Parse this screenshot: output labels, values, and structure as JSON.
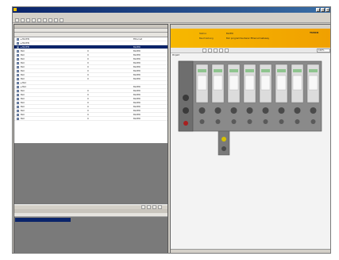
{
  "colors": {
    "title_bar": "#0a246a",
    "header_band": "#f7b800",
    "selection": "#0a246a"
  },
  "tree": {
    "rows": [
      {
        "name": "▸ BLCEN",
        "col2": "",
        "col3": "",
        "col4": "",
        "type": "Ethernet",
        "sel": false
      },
      {
        "name": "▸ BLCEN",
        "col2": "",
        "col3": "",
        "col4": "",
        "type": "",
        "sel": false
      },
      {
        "name": "▸ BLCEN",
        "col2": "",
        "col3": "",
        "col4": "",
        "type": "BLCEN",
        "sel": true
      },
      {
        "name": "BLC",
        "col2": "0",
        "col3": "",
        "col4": "",
        "type": "BLCEN",
        "sel": false
      },
      {
        "name": "BLC",
        "col2": "0",
        "col3": "",
        "col4": "",
        "type": "BLCEN",
        "sel": false
      },
      {
        "name": "BLC",
        "col2": "0",
        "col3": "",
        "col4": "",
        "type": "BLCEN",
        "sel": false
      },
      {
        "name": "BLC",
        "col2": "0",
        "col3": "",
        "col4": "",
        "type": "BLCEN",
        "sel": false
      },
      {
        "name": "BLC",
        "col2": "0",
        "col3": "",
        "col4": "",
        "type": "BLCEN",
        "sel": false
      },
      {
        "name": "BLC",
        "col2": "0",
        "col3": "",
        "col4": "",
        "type": "BLCEN",
        "sel": false
      },
      {
        "name": "BLC",
        "col2": "0",
        "col3": "",
        "col4": "",
        "type": "BLCEN",
        "sel": false
      },
      {
        "name": "BLC",
        "col2": "0",
        "col3": "",
        "col4": "",
        "type": "BLCEN",
        "sel": false
      },
      {
        "name": "▸ BLC",
        "col2": "",
        "col3": "",
        "col4": "",
        "type": "",
        "sel": false
      },
      {
        "name": "▸ BLC",
        "col2": "",
        "col3": "",
        "col4": "",
        "type": "BLCEN",
        "sel": false
      },
      {
        "name": "BLC",
        "col2": "0",
        "col3": "",
        "col4": "",
        "type": "BLCEN",
        "sel": false
      },
      {
        "name": "BLC",
        "col2": "0",
        "col3": "",
        "col4": "",
        "type": "BLCEN",
        "sel": false
      },
      {
        "name": "BLC",
        "col2": "0",
        "col3": "",
        "col4": "",
        "type": "BLCEN",
        "sel": false
      },
      {
        "name": "BLC",
        "col2": "0",
        "col3": "",
        "col4": "",
        "type": "BLCEN",
        "sel": false
      },
      {
        "name": "BLC",
        "col2": "0",
        "col3": "",
        "col4": "",
        "type": "BLCEN",
        "sel": false
      },
      {
        "name": "BLC",
        "col2": "0",
        "col3": "",
        "col4": "",
        "type": "BLCEN",
        "sel": false
      },
      {
        "name": "BLC",
        "col2": "0",
        "col3": "",
        "col4": "",
        "type": "BLCEN",
        "sel": false
      },
      {
        "name": "BLC",
        "col2": "0",
        "col3": "",
        "col4": "",
        "type": "BLCEN",
        "sel": false
      }
    ]
  },
  "right": {
    "header": {
      "label1": "Station",
      "value1": "BLCEN",
      "label2": "Beschreibung",
      "value2": "BLC programmierbarer Ethernet Gateway",
      "logo": "TURCK"
    },
    "zoom": "100%",
    "canvas_label": "Projekt"
  }
}
